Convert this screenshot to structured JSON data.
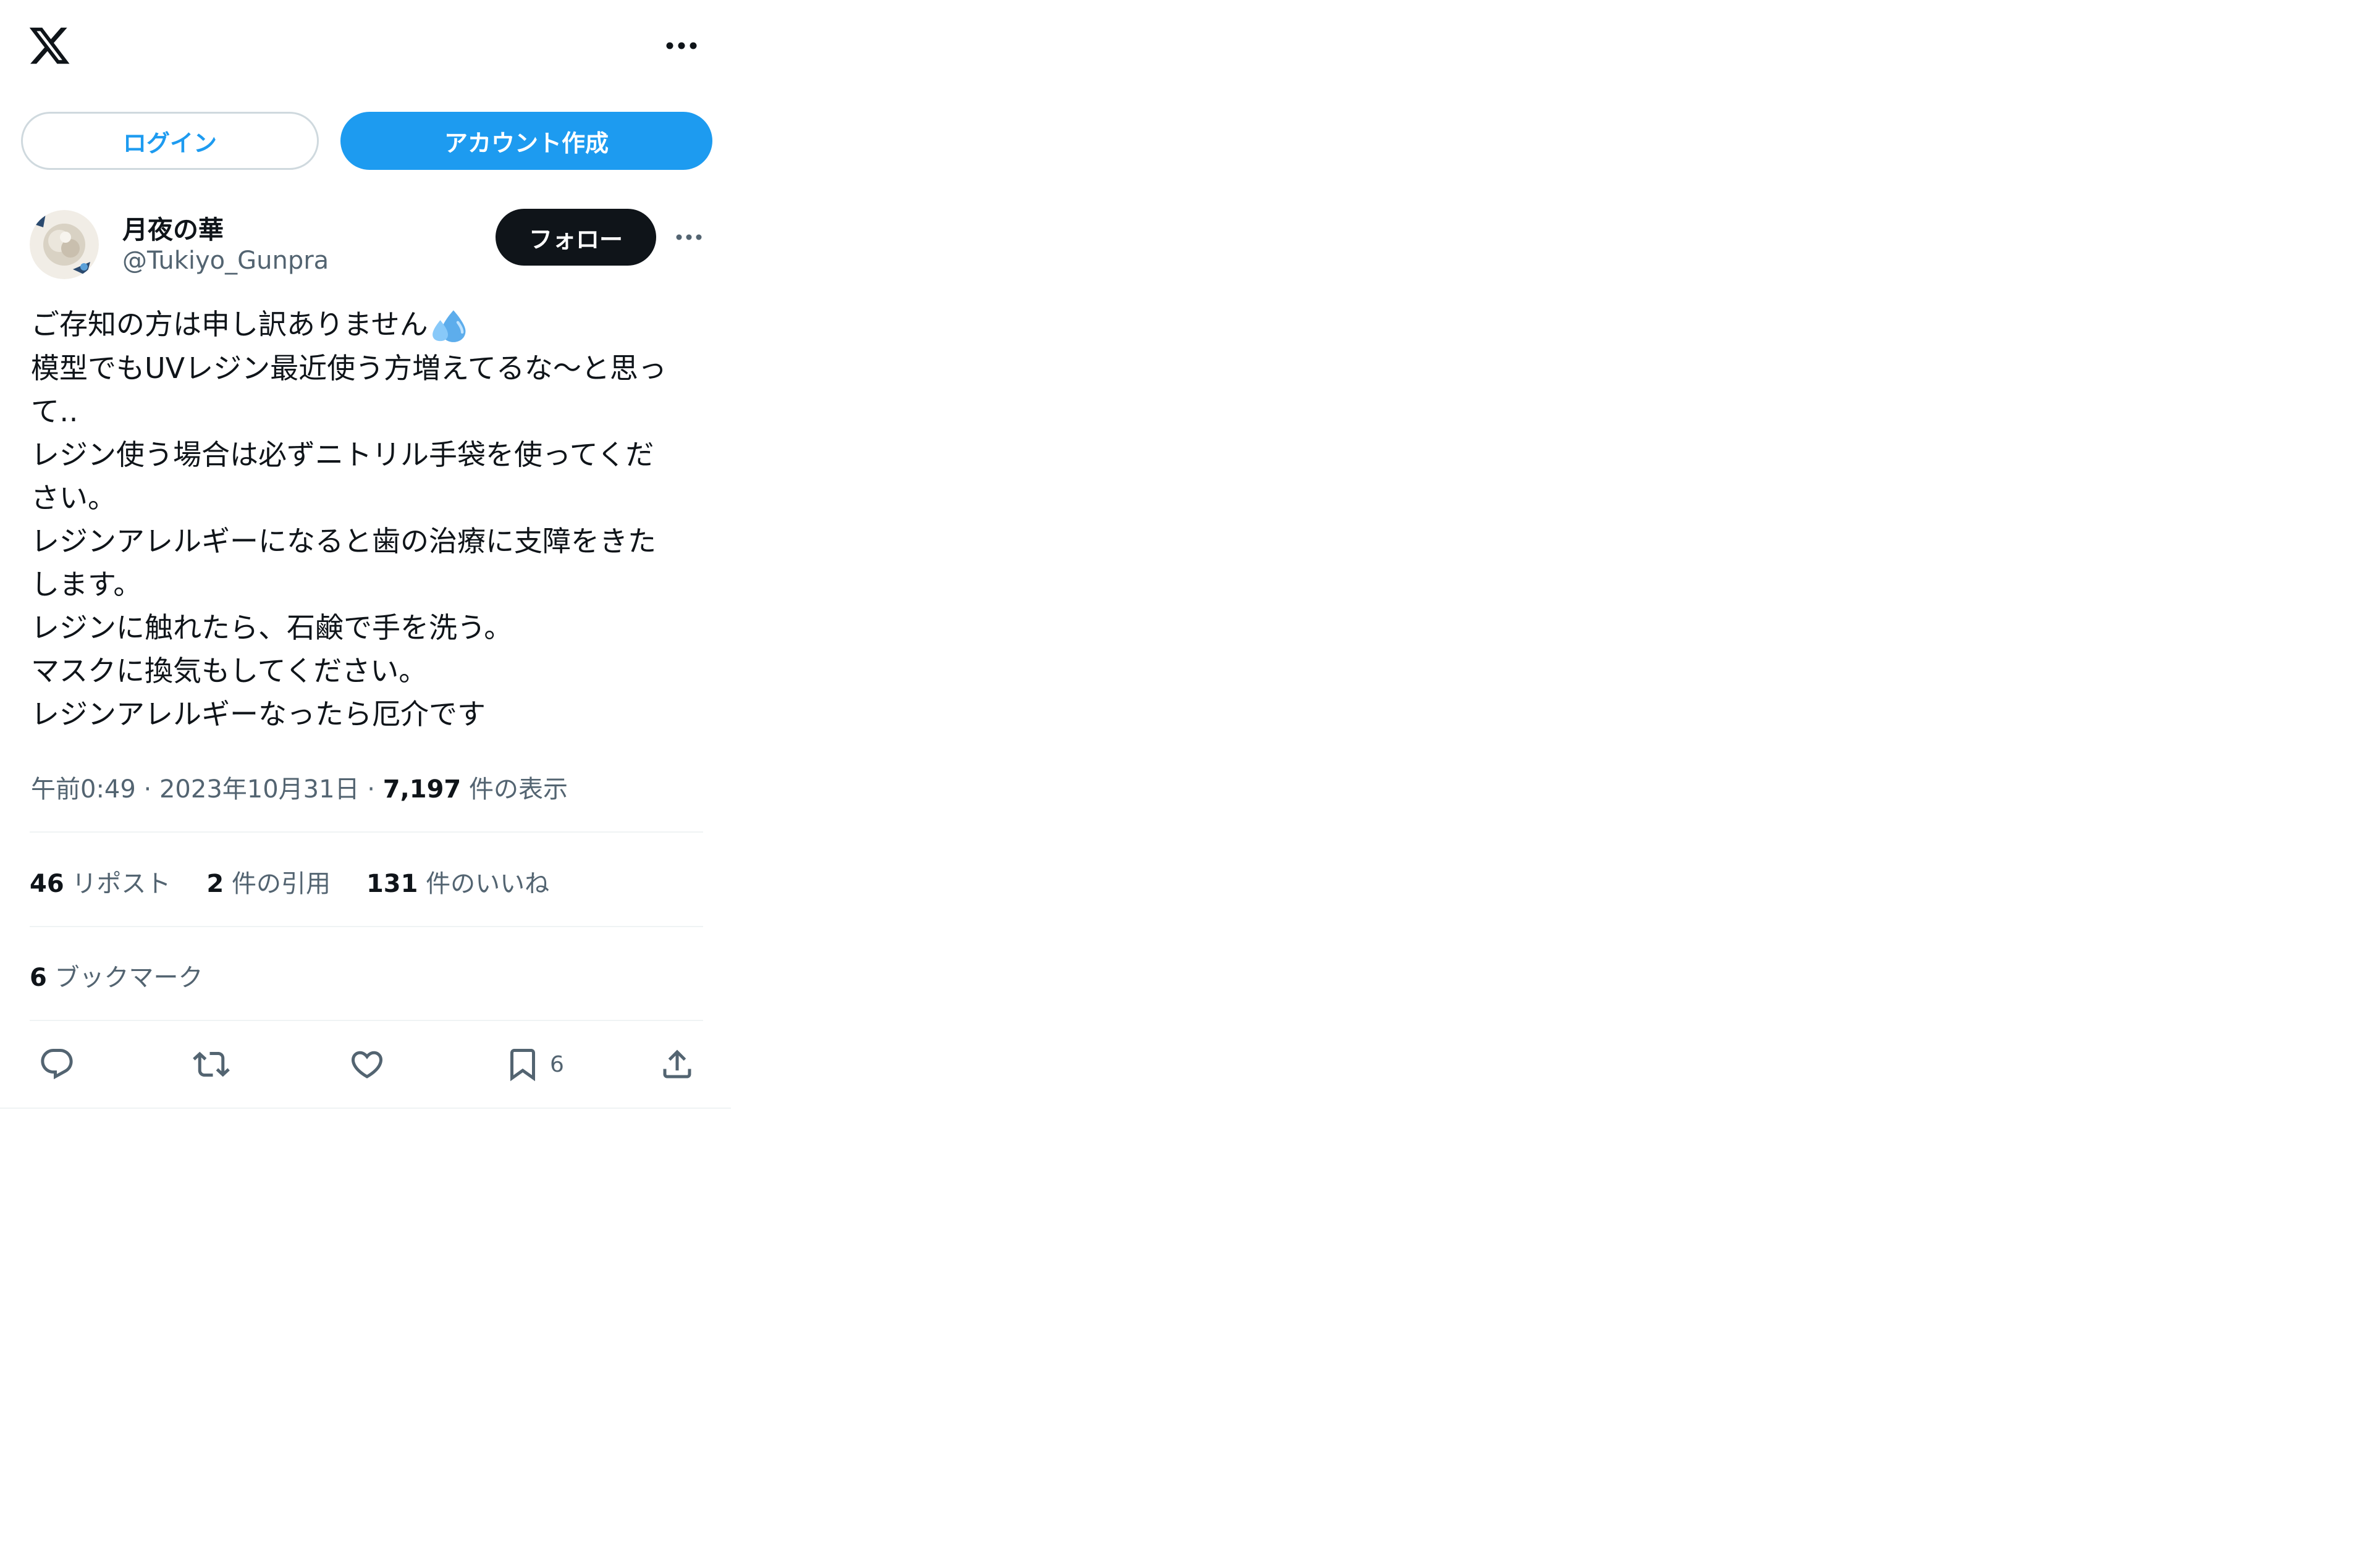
{
  "header": {
    "logo": "x-logo-icon",
    "more_icon": "more-horizontal-icon"
  },
  "auth": {
    "login_label": "ログイン",
    "signup_label": "アカウント作成"
  },
  "post": {
    "author": {
      "name": "月夜の華",
      "handle": "@Tukiyo_Gunpra"
    },
    "follow_label": "フォロー",
    "lines": [
      "ご存知の方は申し訳ありません",
      "模型でもUVレジン最近使う方増えてるな〜と思っ",
      "て‥",
      "レジン使う場合は必ずニトリル手袋を使ってくだ",
      "さい。",
      "レジンアレルギーになると歯の治療に支障をきた",
      "します。",
      "レジンに触れたら、石鹸で手を洗う。",
      "マスクに換気もしてください。",
      "レジンアレルギーなったら厄介です"
    ],
    "emoji": "sweat-droplets-emoji",
    "timestamp": "午前0:49",
    "date": "2023年10月31日",
    "separator": "·",
    "views_count": "7,197",
    "views_label": "件の表示",
    "stats": {
      "reposts_count": "46",
      "reposts_label": "リポスト",
      "quotes_count": "2",
      "quotes_label": "件の引用",
      "likes_count": "131",
      "likes_label": "件のいいね"
    },
    "bookmarks_count": "6",
    "bookmarks_label": "ブックマーク",
    "actions": {
      "reply_icon": "reply-icon",
      "repost_icon": "repost-icon",
      "like_icon": "like-icon",
      "bookmark_icon": "bookmark-icon",
      "bookmark_count": "6",
      "share_icon": "share-icon"
    }
  },
  "colors": {
    "accent": "#1d9bf0",
    "text": "#0f1419",
    "secondary": "#536471",
    "border": "#cfd9de",
    "divider": "#eff3f4"
  }
}
